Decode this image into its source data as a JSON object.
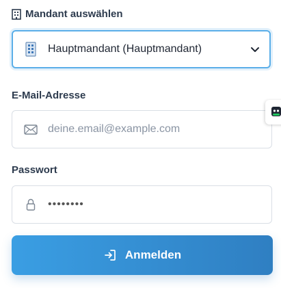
{
  "tenant": {
    "label": "Mandant auswählen",
    "selected": "Hauptmandant (Hauptmandant)"
  },
  "email": {
    "label": "E-Mail-Adresse",
    "placeholder": "deine.email@example.com"
  },
  "password": {
    "label": "Passwort",
    "masked_value": "••••••••"
  },
  "submit": {
    "label": "Anmelden"
  },
  "colors": {
    "accent": "#3a9ee3",
    "button_end": "#2f7fc2",
    "focus_border": "#5aaee8",
    "widget_green": "#22c55e"
  },
  "icons": {
    "tenant_label": "office-building-icon",
    "tenant_select": "office-building-icon",
    "dropdown": "chevron-down-icon",
    "email": "envelope-icon",
    "password": "lock-icon",
    "submit": "login-arrow-icon",
    "side_widget": "chat-widget-icon"
  }
}
